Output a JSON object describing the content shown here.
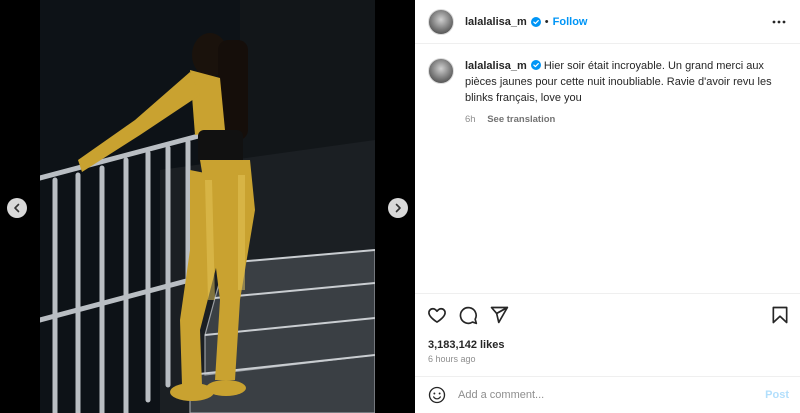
{
  "post": {
    "username": "lalalalisa_m",
    "follow_label": "Follow",
    "separator": "•",
    "caption": "Hier soir était incroyable. Un grand merci aux pièces jaunes pour cette nuit inoubliable. Ravie d'avoir revu les blinks français, love you",
    "time_short": "6h",
    "see_translation": "See translation",
    "likes": "3,183,142 likes",
    "time_ago": "6 hours ago"
  },
  "comment": {
    "placeholder": "Add a comment...",
    "post_label": "Post"
  },
  "colors": {
    "accent": "#0095f6",
    "verified": "#0095f6",
    "post_disabled": "#b2dffc"
  },
  "icons": {
    "nav_left": "chevron-left-icon",
    "nav_right": "chevron-right-icon",
    "verified": "verified-badge-icon",
    "more": "more-options-icon",
    "like": "heart-icon",
    "comment": "comment-icon",
    "share": "share-icon",
    "save": "bookmark-icon",
    "emoji": "emoji-icon"
  }
}
